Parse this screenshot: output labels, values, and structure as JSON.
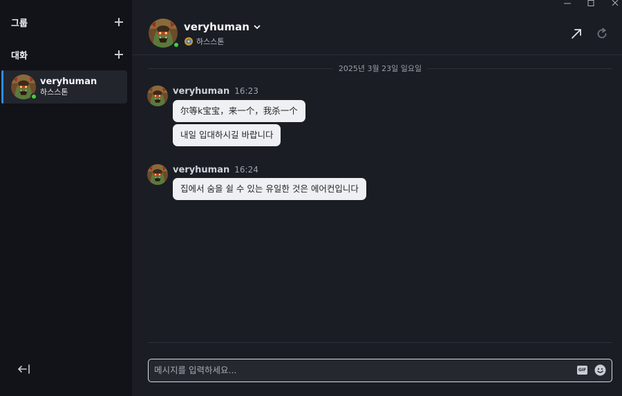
{
  "sidebar": {
    "groups_label": "그룹",
    "conversations_label": "대화",
    "conversations": [
      {
        "name": "veryhuman",
        "game": "하스스톤",
        "status": "online",
        "active": true
      }
    ]
  },
  "chat": {
    "contact_name": "veryhuman",
    "contact_game": "하스스톤",
    "date_divider": "2025년 3월 23일 일요일",
    "messages": [
      {
        "author": "veryhuman",
        "time": "16:23",
        "bubbles": [
          "尔等k宝宝，来一个，我杀一个",
          "내일 입대하시길 바랍니다"
        ]
      },
      {
        "author": "veryhuman",
        "time": "16:24",
        "bubbles": [
          "집에서 숨을 쉴 수 있는 유일한 것은 에어컨입니다"
        ]
      }
    ],
    "composer_placeholder": "메시지를 입력하세요...",
    "gif_label": "GIF"
  },
  "colors": {
    "accent": "#2d8cf0",
    "online": "#3fd43a",
    "bubble_bg": "#eef0f3"
  },
  "icons": {
    "add": "plus-icon",
    "collapse": "collapse-left-icon",
    "popout": "arrow-up-right-icon",
    "refresh": "refresh-icon",
    "game": "hearthstone-icon",
    "emoji": "smiley-icon"
  }
}
